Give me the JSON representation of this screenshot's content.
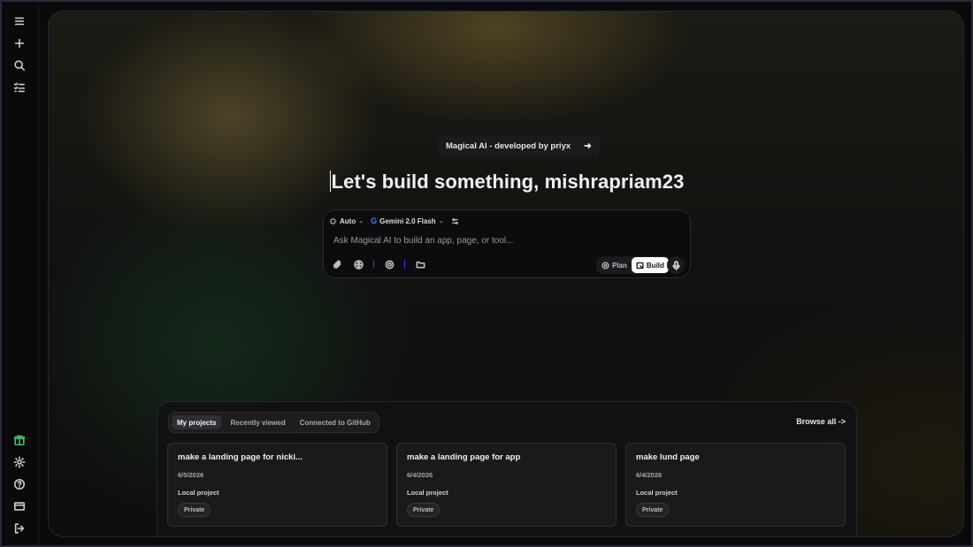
{
  "sidebar": {
    "icons": [
      "menu-icon",
      "plus-icon",
      "search-icon",
      "list-icon",
      "gift-icon",
      "gear-icon",
      "help-icon",
      "card-icon",
      "logout-icon"
    ]
  },
  "announcement": {
    "text": "Magical AI - developed by priyx"
  },
  "headline": {
    "text": "Let's build something, mishrapriam23"
  },
  "prompt": {
    "mode_label": "Auto",
    "model_label": "Gemini 2.0 Flash",
    "placeholder": "Ask Magical AI to build an app, page, or tool...",
    "value": "",
    "plan_label": "Plan",
    "build_label": "Build"
  },
  "projects": {
    "tabs": [
      {
        "label": "My projects",
        "active": true
      },
      {
        "label": "Recently viewed",
        "active": false
      },
      {
        "label": "Connected to GitHub",
        "active": false
      }
    ],
    "browse_label": "Browse all ->",
    "cards": [
      {
        "title": "make a landing page for nicki...",
        "date": "6/5/2026",
        "type": "Local project",
        "visibility": "Private"
      },
      {
        "title": "make a landing page for app",
        "date": "6/4/2026",
        "type": "Local project",
        "visibility": "Private"
      },
      {
        "title": "make lund page",
        "date": "6/4/2026",
        "type": "Local project",
        "visibility": "Private"
      }
    ]
  },
  "colors": {
    "accent_green": "#3fbf6b",
    "background": "#0b0b0d",
    "build_button": "#ffffff"
  }
}
